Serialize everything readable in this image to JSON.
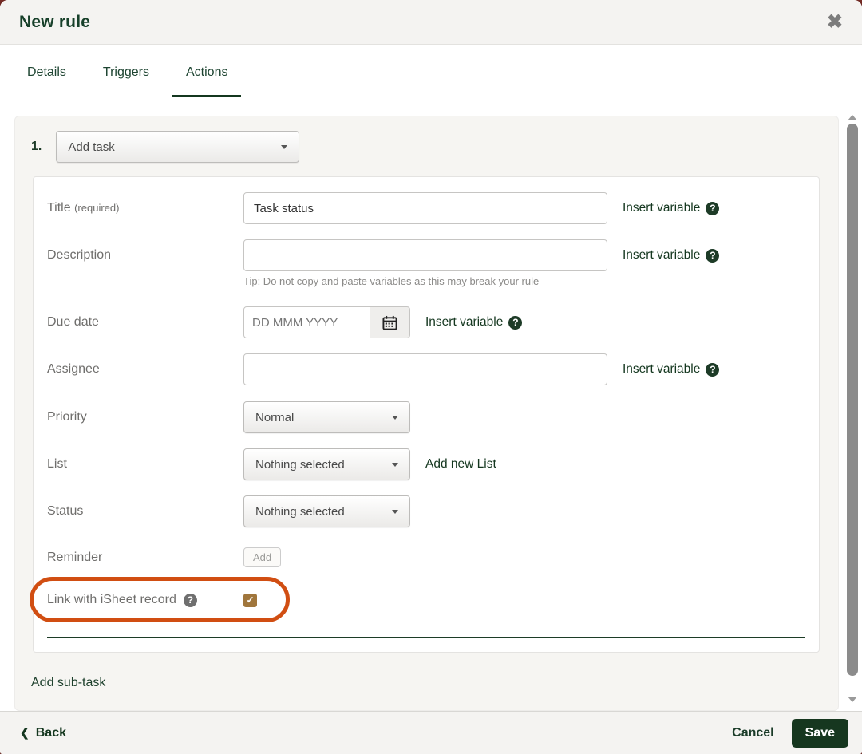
{
  "header": {
    "title": "New rule"
  },
  "tabs": [
    {
      "label": "Details",
      "active": false
    },
    {
      "label": "Triggers",
      "active": false
    },
    {
      "label": "Actions",
      "active": true
    }
  ],
  "ui": {
    "insert_variable_label": "Insert variable"
  },
  "icons": {
    "close": "✖",
    "question": "?",
    "check": "✓",
    "chevron_left": "❮"
  },
  "rule": {
    "index": "1.",
    "action_select": {
      "value": "Add task"
    },
    "fields": {
      "title": {
        "label": "Title",
        "required_suffix": "(required)",
        "value": "Task status"
      },
      "description": {
        "label": "Description",
        "value": "",
        "tip": "Tip: Do not copy and paste variables as this may break your rule"
      },
      "due_date": {
        "label": "Due date",
        "placeholder": "DD MMM YYYY"
      },
      "assignee": {
        "label": "Assignee",
        "value": ""
      },
      "priority": {
        "label": "Priority",
        "value": "Normal"
      },
      "list": {
        "label": "List",
        "value": "Nothing selected",
        "add_new_label": "Add new List"
      },
      "status": {
        "label": "Status",
        "value": "Nothing selected"
      },
      "reminder": {
        "label": "Reminder",
        "add_button": "Add"
      },
      "isheet": {
        "label": "Link with iSheet record",
        "checked": true
      }
    }
  },
  "add_subtask_label": "Add sub-task",
  "footer": {
    "back": "Back",
    "cancel": "Cancel",
    "save": "Save"
  },
  "annotation": {
    "type": "highlight-oval",
    "target": "Link with iSheet record",
    "color": "#d14e12"
  },
  "colors": {
    "accent_green": "#17402a",
    "save_button": "#16371f",
    "checkbox_brown": "#a0763c",
    "annotation_orange": "#d14e12",
    "header_bg": "#f4f3f1",
    "panel_bg": "#f6f5f2"
  }
}
